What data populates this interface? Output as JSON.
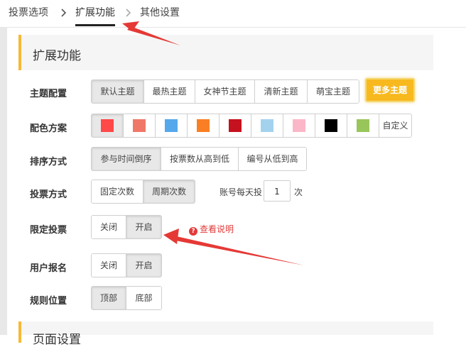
{
  "tabs": [
    {
      "label": "投票选项"
    },
    {
      "label": "扩展功能"
    },
    {
      "label": "其他设置"
    }
  ],
  "panel": {
    "title": "扩展功能",
    "next_section_title": "页面设置"
  },
  "theme": {
    "label": "主题配置",
    "options": [
      "默认主题",
      "最热主题",
      "女神节主题",
      "清新主题",
      "萌宝主题"
    ],
    "selected": "默认主题",
    "more_label": "更多主题"
  },
  "colors": {
    "label": "配色方案",
    "swatches": [
      "#ff4848",
      "#f07868",
      "#56a8ec",
      "#fa7f24",
      "#c5121e",
      "#a3d2ee",
      "#fbb7c7",
      "#000000",
      "#98c65a"
    ],
    "custom_label": "自定义"
  },
  "sort": {
    "label": "排序方式",
    "options": [
      "参与时间倒序",
      "按票数从高到低",
      "编号从低到高"
    ],
    "selected": "参与时间倒序"
  },
  "vote_mode": {
    "label": "投票方式",
    "options": [
      "固定次数",
      "周期次数"
    ],
    "selected": "周期次数",
    "per_day_prefix": "账号每天投",
    "per_day_value": "1",
    "per_day_suffix": "次"
  },
  "limit_vote": {
    "label": "限定投票",
    "options": [
      "关闭",
      "开启"
    ],
    "selected": "开启",
    "help_text": "查看说明",
    "help_icon": "?"
  },
  "signup": {
    "label": "用户报名",
    "options": [
      "关闭",
      "开启"
    ],
    "selected": "开启"
  },
  "rules_position": {
    "label": "规则位置",
    "options": [
      "顶部",
      "底部"
    ],
    "selected": "顶部"
  }
}
